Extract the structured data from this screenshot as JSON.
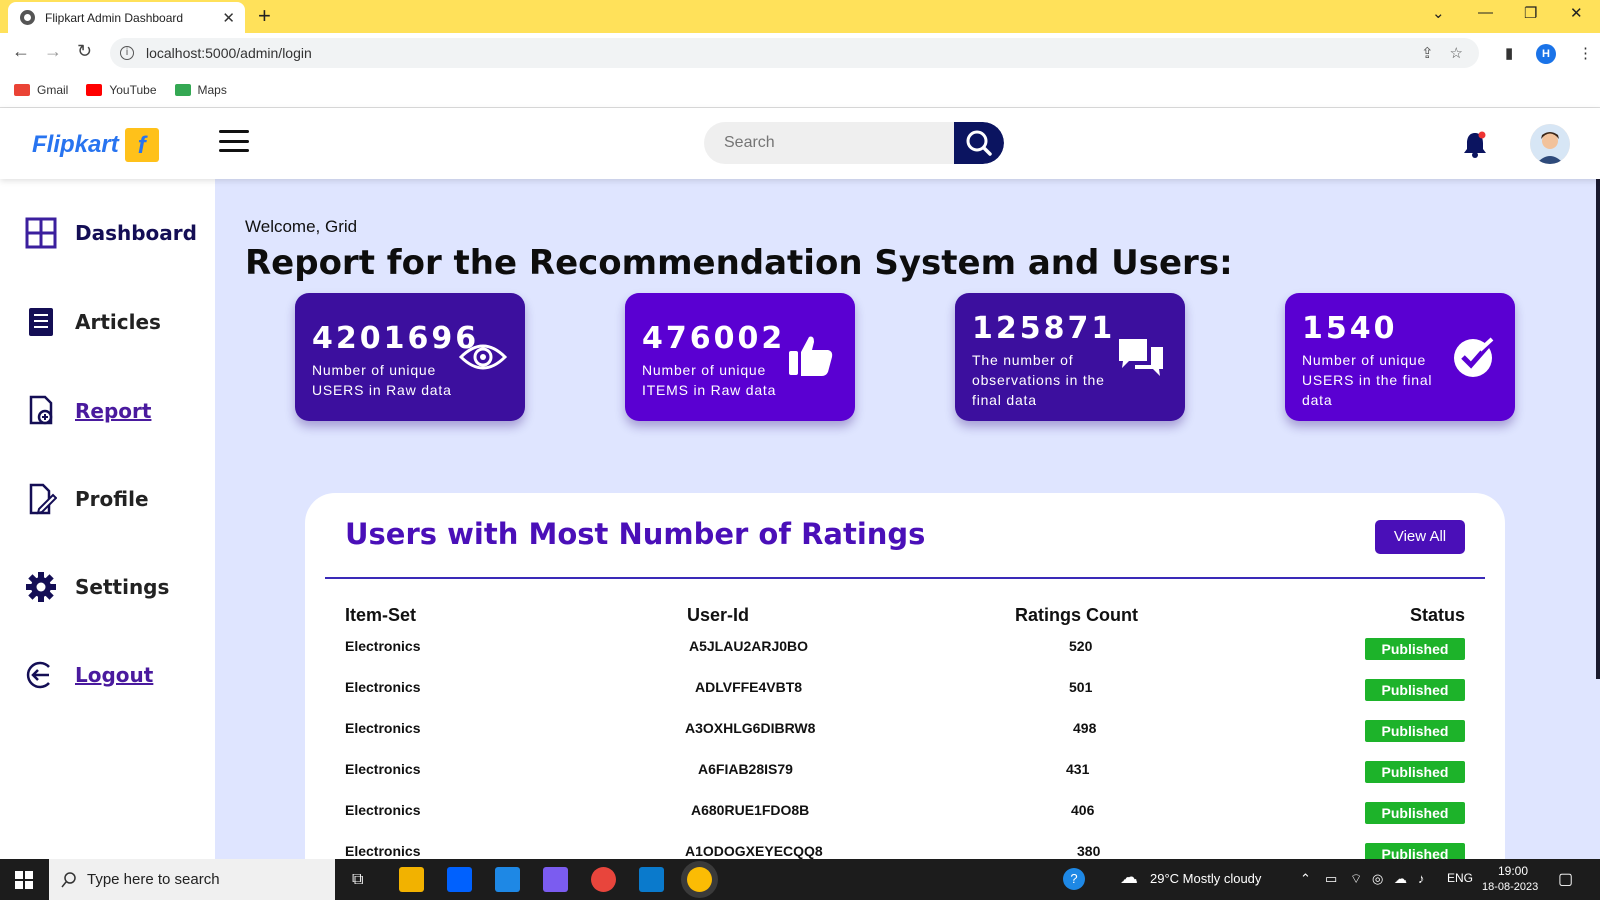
{
  "browser": {
    "tab_title": "Flipkart Admin Dashboard",
    "url": "localhost:5000/admin/login",
    "profile_initial": "H",
    "bookmarks": [
      {
        "label": "Gmail",
        "color": "#ea4335"
      },
      {
        "label": "YouTube",
        "color": "#ff0000"
      },
      {
        "label": "Maps",
        "color": "#34a853"
      }
    ]
  },
  "header": {
    "logo_text": "Flipkart",
    "search_placeholder": "Search"
  },
  "sidebar": {
    "items": [
      {
        "label": "Dashboard",
        "icon": "grid-icon"
      },
      {
        "label": "Articles",
        "icon": "article-icon"
      },
      {
        "label": "Report",
        "icon": "report-icon"
      },
      {
        "label": "Profile",
        "icon": "profile-icon"
      },
      {
        "label": "Settings",
        "icon": "gear-icon"
      },
      {
        "label": "Logout",
        "icon": "logout-icon"
      }
    ]
  },
  "main": {
    "welcome": "Welcome, Grid",
    "title": "Report for the Recommendation System and Users:",
    "cards": [
      {
        "value": "4201696",
        "description": "Number of unique USERS in Raw data",
        "icon": "eye-icon"
      },
      {
        "value": "476002",
        "description": "Number of unique ITEMS in Raw data",
        "icon": "thumbs-up-icon"
      },
      {
        "value": "125871",
        "description": "The number of observations in the final data",
        "icon": "chat-icon"
      },
      {
        "value": "1540",
        "description": "Number of unique USERS in the final data",
        "icon": "check-circle-icon"
      }
    ]
  },
  "ratings_table": {
    "title": "Users with Most Number of Ratings",
    "view_all_label": "View All",
    "columns": [
      "Item-Set",
      "User-Id",
      "Ratings Count",
      "Status"
    ],
    "rows": [
      {
        "item_set": "Electronics",
        "user_id": "A5JLAU2ARJ0BO",
        "count": "520",
        "status": "Published"
      },
      {
        "item_set": "Electronics",
        "user_id": "ADLVFFE4VBT8",
        "count": "501",
        "status": "Published"
      },
      {
        "item_set": "Electronics",
        "user_id": "A3OXHLG6DIBRW8",
        "count": "498",
        "status": "Published"
      },
      {
        "item_set": "Electronics",
        "user_id": "A6FIAB28IS79",
        "count": "431",
        "status": "Published"
      },
      {
        "item_set": "Electronics",
        "user_id": "A680RUE1FDO8B",
        "count": "406",
        "status": "Published"
      },
      {
        "item_set": "Electronics",
        "user_id": "A1ODOGXEYECQQ8",
        "count": "380",
        "status": "Published"
      }
    ]
  },
  "taskbar": {
    "search_placeholder": "Type here to search",
    "weather": "29°C  Mostly cloudy",
    "language": "ENG",
    "time": "19:00",
    "date": "18-08-2023"
  },
  "colors": {
    "card_dark": "#3c0f9e",
    "card_bright": "#5a00d2",
    "status_green": "#1db32a",
    "main_bg": "#dfe5ff"
  }
}
